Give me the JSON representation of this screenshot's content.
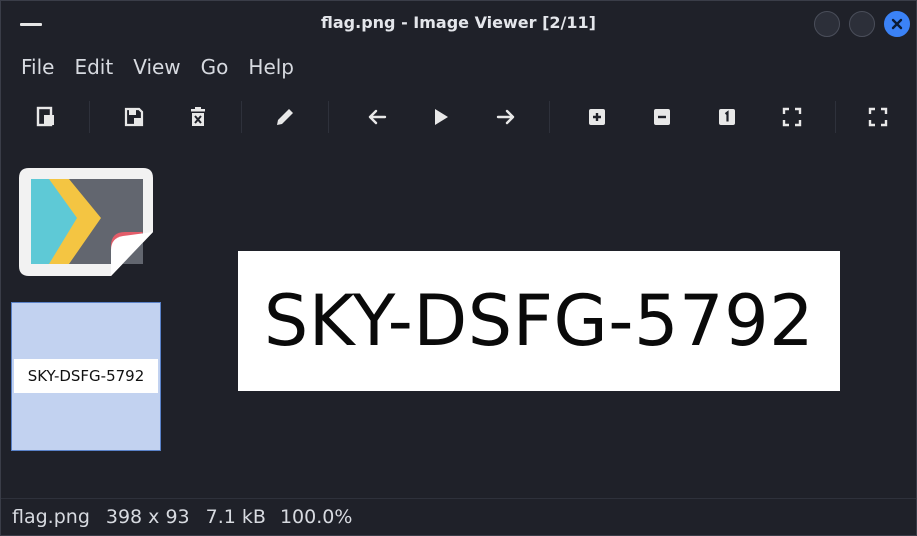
{
  "window": {
    "title": "flag.png - Image Viewer [2/11]",
    "accent": "#3b82f6"
  },
  "menubar": {
    "items": [
      {
        "label": "File"
      },
      {
        "label": "Edit"
      },
      {
        "label": "View"
      },
      {
        "label": "Go"
      },
      {
        "label": "Help"
      }
    ]
  },
  "toolbar": {
    "buttons": [
      {
        "icon": "open-image-icon"
      },
      {
        "icon": "save-icon"
      },
      {
        "icon": "delete-icon"
      },
      {
        "icon": "edit-icon"
      },
      {
        "icon": "arrow-left-icon"
      },
      {
        "icon": "play-icon"
      },
      {
        "icon": "arrow-right-icon"
      },
      {
        "icon": "zoom-in-icon"
      },
      {
        "icon": "zoom-out-icon"
      },
      {
        "icon": "zoom-original-icon"
      },
      {
        "icon": "zoom-fit-icon"
      },
      {
        "icon": "fullscreen-icon"
      }
    ]
  },
  "thumbnails": {
    "selected_text": "SKY-DSFG-5792"
  },
  "image": {
    "text": "SKY-DSFG-5792"
  },
  "status": {
    "filename": "flag.png",
    "dimensions": "398 x 93",
    "size": "7.1 kB",
    "zoom": "100.0%"
  }
}
